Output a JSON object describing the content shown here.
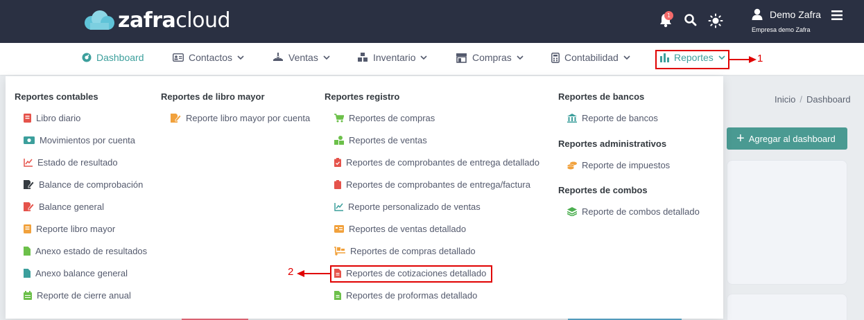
{
  "brand": {
    "name_bold": "zafra",
    "name_light": "cloud"
  },
  "header": {
    "notification_count": "1",
    "user_name": "Demo Zafra",
    "company": "Empresa demo Zafra"
  },
  "nav": [
    {
      "label": "Dashboard",
      "icon": "dashboard-icon"
    },
    {
      "label": "Contactos",
      "icon": "contacts-icon"
    },
    {
      "label": "Ventas",
      "icon": "sales-icon"
    },
    {
      "label": "Inventario",
      "icon": "inventory-icon"
    },
    {
      "label": "Compras",
      "icon": "store-icon"
    },
    {
      "label": "Contabilidad",
      "icon": "calculator-icon"
    },
    {
      "label": "Reportes",
      "icon": "bar-chart-icon"
    }
  ],
  "breadcrumb": {
    "home": "Inicio",
    "current": "Dashboard"
  },
  "add_dashboard": "Agregar al dashboard",
  "menu": {
    "contables": {
      "title": "Reportes contables",
      "items": [
        "Libro diario",
        "Movimientos por cuenta",
        "Estado de resultado",
        "Balance de comprobación",
        "Balance general",
        "Reporte libro mayor",
        "Anexo estado de resultados",
        "Anexo balance general",
        "Reporte de cierre anual"
      ]
    },
    "libro_mayor": {
      "title": "Reportes de libro mayor",
      "items": [
        "Reporte libro mayor por cuenta"
      ]
    },
    "registro": {
      "title": "Reportes registro",
      "items": [
        "Reportes de compras",
        "Reportes de ventas",
        "Reportes de comprobantes de entrega detallado",
        "Reportes de comprobantes de entrega/factura",
        "Reporte personalizado de ventas",
        "Reportes de ventas detallado",
        "Reportes de compras detallado",
        "Reportes de cotizaciones detallado",
        "Reportes de proformas detallado"
      ]
    },
    "bancos": {
      "title": "Reportes de bancos",
      "items": [
        "Reporte de bancos"
      ]
    },
    "administrativos": {
      "title": "Reportes administrativos",
      "items": [
        "Reporte de impuestos"
      ]
    },
    "combos": {
      "title": "Reportes de combos",
      "items": [
        "Reporte de combos detallado"
      ]
    }
  },
  "annotations": {
    "step1": "1",
    "step2": "2"
  },
  "colors": {
    "topbar": "#2a3042",
    "accent": "#3c9f9c",
    "highlight": "#e00000"
  }
}
